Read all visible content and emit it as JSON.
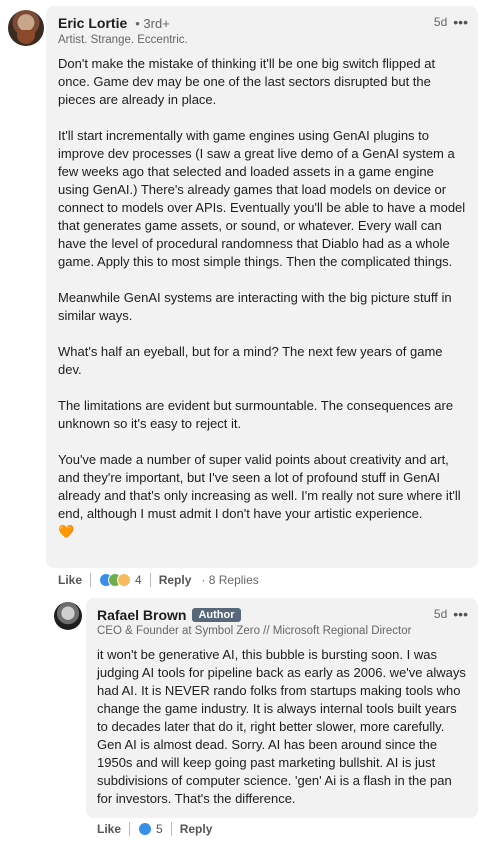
{
  "comment1": {
    "author_name": "Eric Lortie",
    "degree": "• 3rd+",
    "headline": "Artist. Strange. Eccentric.",
    "time": "5d",
    "more": "•••",
    "paragraphs": [
      "Don't make the mistake of thinking it'll be one big switch flipped at once. Game dev may be one of the last sectors disrupted but the pieces are already in place.",
      "It'll start incrementally with game engines using GenAI plugins to improve dev processes (I saw a great live demo of a GenAI system a few weeks ago that selected and loaded assets in a game engine using GenAI.) There's already games that load models on device or connect to models over APIs. Eventually you'll be able to have a model that generates game assets, or sound, or whatever. Every wall can have the level of procedural randomness that Diablo had as a whole game. Apply this to most simple things. Then the complicated things.",
      "Meanwhile GenAI systems are interacting with the big picture stuff in similar ways.",
      "What's half an eyeball, but for a mind? The next few years of game dev.",
      "The limitations are evident but surmountable. The consequences are unknown so it's easy to reject it.",
      "You've made a number of super valid points about creativity and art, and they're important, but I've seen a lot of profound stuff in GenAI already and that's only increasing as well. I'm really not sure where it'll end, although I must admit I don't have your artistic experience."
    ],
    "emoji": "🧡",
    "like_label": "Like",
    "reaction_count": "4",
    "reply_label": "Reply",
    "replies_count": "· 8 Replies"
  },
  "comment2": {
    "author_name": "Rafael Brown",
    "author_badge": "Author",
    "headline": "CEO & Founder at Symbol Zero // Microsoft Regional Director",
    "time": "5d",
    "more": "•••",
    "text": "it won't be generative AI, this bubble is bursting soon. I was judging AI tools for pipeline back as early as 2006. we've always had AI. It is NEVER rando folks from startups making tools who change the game industry. It is always internal tools built years to decades later that do it, right better slower, more carefully. Gen AI is almost dead. Sorry. AI has been around since the 1950s and will keep going past marketing bullshit. AI is just subdivisions of computer science. 'gen' Ai is a flash in the pan for investors. That's the difference.",
    "like_label": "Like",
    "reaction_count": "5",
    "reply_label": "Reply"
  },
  "colors": {
    "like_blue": "#378fe9",
    "celebrate_green": "#44712e",
    "insightful_yellow": "#f5bb5c",
    "badge_gray": "#56687a"
  }
}
